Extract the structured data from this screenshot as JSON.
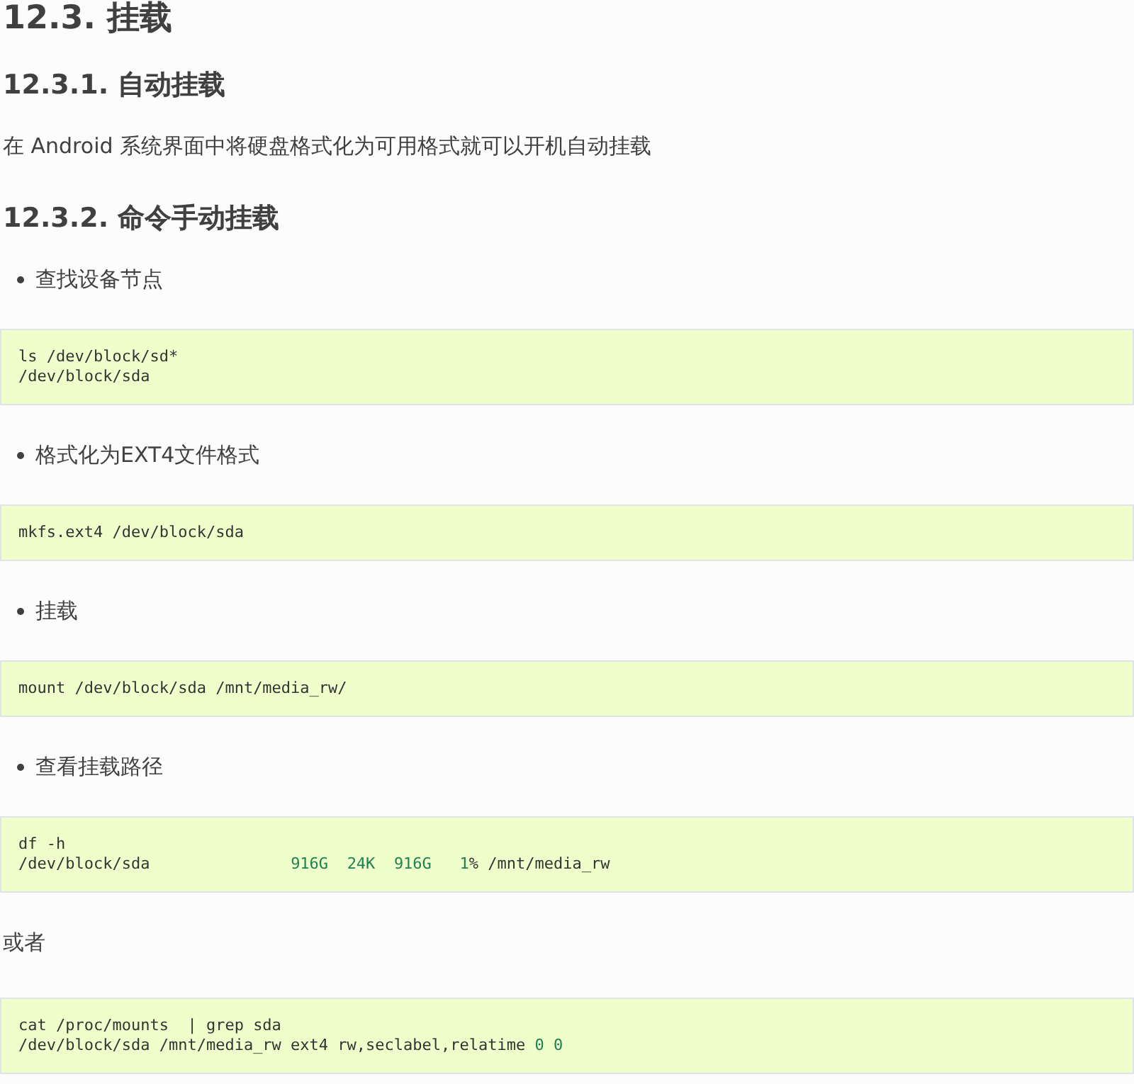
{
  "title": "12.3. 挂载",
  "sections": [
    {
      "heading": "12.3.1. 自动挂载",
      "items": [
        {
          "kind": "paragraph",
          "text": "在 Android 系统界面中将硬盘格式化为可用格式就可以开机自动挂载"
        }
      ]
    },
    {
      "heading": "12.3.2. 命令手动挂载",
      "items": [
        {
          "kind": "bullet",
          "text": "查找设备节点"
        },
        {
          "kind": "code",
          "lines": [
            [
              {
                "kind": "plain",
                "text": "ls /dev/block/sd*"
              }
            ],
            [
              {
                "kind": "plain",
                "text": "/dev/block/sda"
              }
            ]
          ]
        },
        {
          "kind": "bullet",
          "text": "格式化为EXT4文件格式"
        },
        {
          "kind": "code",
          "lines": [
            [
              {
                "kind": "plain",
                "text": "mkfs.ext4 /dev/block/sda"
              }
            ]
          ]
        },
        {
          "kind": "bullet",
          "text": "挂载"
        },
        {
          "kind": "code",
          "lines": [
            [
              {
                "kind": "plain",
                "text": "mount /dev/block/sda /mnt/media_rw/"
              }
            ]
          ]
        },
        {
          "kind": "bullet",
          "text": "查看挂载路径"
        },
        {
          "kind": "code",
          "lines": [
            [
              {
                "kind": "plain",
                "text": "df -h"
              }
            ],
            [
              {
                "kind": "plain",
                "text": "/dev/block/sda               "
              },
              {
                "kind": "number",
                "text": "916G  "
              },
              {
                "kind": "number",
                "text": "24K  "
              },
              {
                "kind": "number",
                "text": "916G   "
              },
              {
                "kind": "number",
                "text": "1"
              },
              {
                "kind": "plain",
                "text": "% /mnt/media_rw"
              }
            ]
          ]
        },
        {
          "kind": "paragraph",
          "text": "或者"
        },
        {
          "kind": "code",
          "lines": [
            [
              {
                "kind": "plain",
                "text": "cat /proc/mounts  | grep sda"
              }
            ],
            [
              {
                "kind": "plain",
                "text": "/dev/block/sda /mnt/media_rw ext4 rw,seclabel,relatime "
              },
              {
                "kind": "number",
                "text": "0 "
              },
              {
                "kind": "number",
                "text": "0"
              }
            ]
          ]
        }
      ]
    }
  ]
}
